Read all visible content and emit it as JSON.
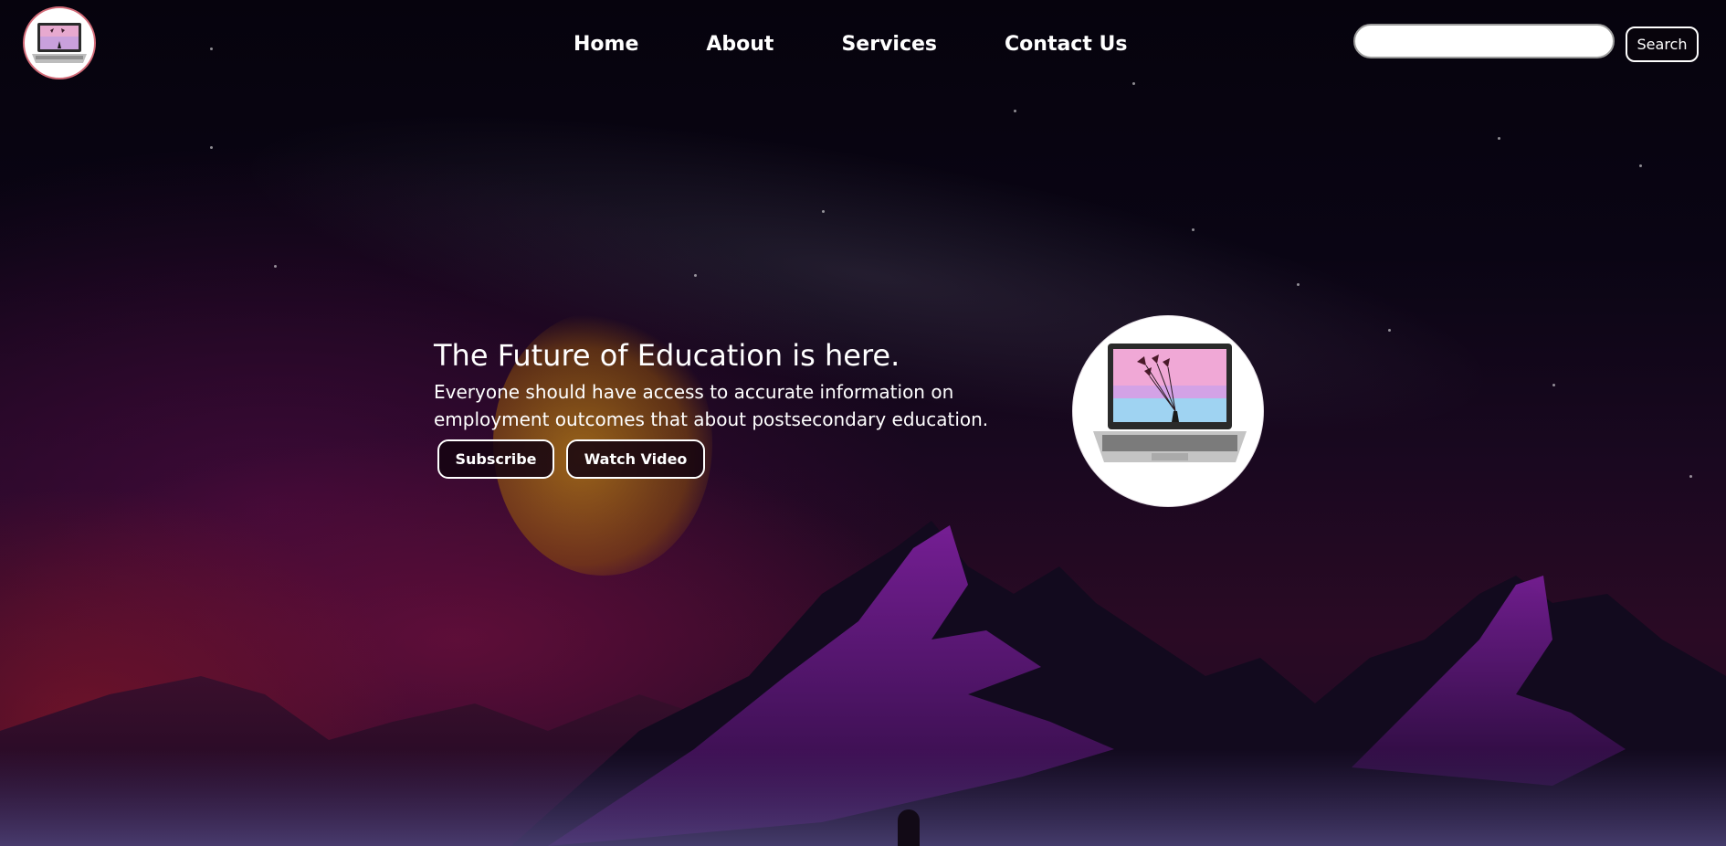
{
  "nav": {
    "items": [
      "Home",
      "About",
      "Services",
      "Contact Us"
    ]
  },
  "search": {
    "placeholder": "",
    "value": "",
    "button_label": "Search"
  },
  "hero": {
    "title": "The Future of Education is here.",
    "subtitle": "Everyone should have access to accurate information on employment outcomes that about postsecondary education.",
    "subscribe_label": "Subscribe",
    "watch_label": "Watch Video"
  },
  "icons": {
    "logo": "laptop-logo-icon",
    "hero_image": "laptop-balloons-icon"
  },
  "colors": {
    "sky_dark": "#07040f",
    "mountain_purple": "#6b1a86",
    "logo_border": "#d26a77",
    "button_bg": "#08040c",
    "text": "#ffffff"
  }
}
